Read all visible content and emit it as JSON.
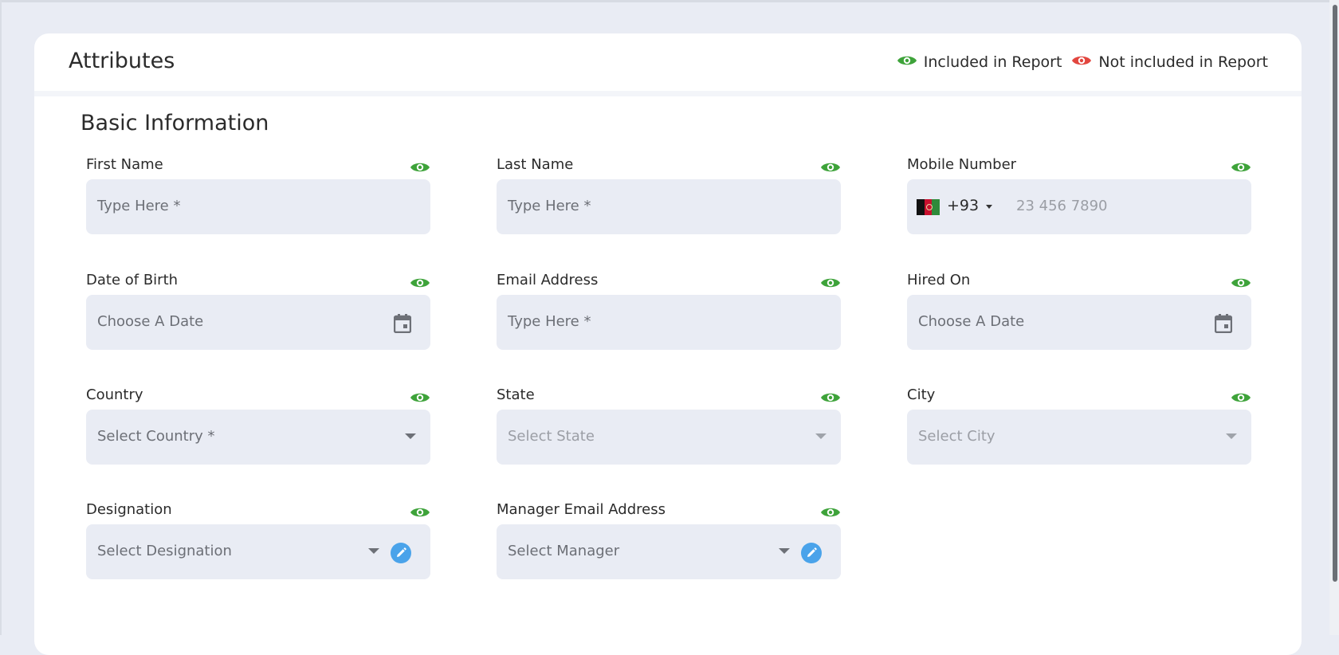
{
  "header": {
    "title": "Attributes",
    "legend": {
      "included": "Included in Report",
      "not_included": "Not included in Report"
    }
  },
  "colors": {
    "included_eye": "#3ea33a",
    "not_included_eye": "#e2463f",
    "edit_button": "#4aa3ea",
    "input_bg": "#e9ecf4"
  },
  "section": {
    "title": "Basic Information"
  },
  "fields": {
    "first_name": {
      "label": "First Name",
      "placeholder": "Type Here *",
      "visibility_icon": "eye-icon"
    },
    "last_name": {
      "label": "Last Name",
      "placeholder": "Type Here *",
      "visibility_icon": "eye-icon"
    },
    "mobile": {
      "label": "Mobile Number",
      "dial_code": "+93",
      "country_flag": "afghanistan-flag-icon",
      "placeholder": "23 456 7890",
      "visibility_icon": "eye-icon"
    },
    "dob": {
      "label": "Date of Birth",
      "placeholder": "Choose A Date",
      "icon": "calendar-icon",
      "visibility_icon": "eye-icon"
    },
    "email": {
      "label": "Email Address",
      "placeholder": "Type Here *",
      "visibility_icon": "eye-icon"
    },
    "hired_on": {
      "label": "Hired On",
      "placeholder": "Choose A Date",
      "icon": "calendar-icon",
      "visibility_icon": "eye-icon"
    },
    "country": {
      "label": "Country",
      "placeholder": "Select Country *",
      "visibility_icon": "eye-icon"
    },
    "state": {
      "label": "State",
      "placeholder": "Select State",
      "visibility_icon": "eye-icon"
    },
    "city": {
      "label": "City",
      "placeholder": "Select City",
      "visibility_icon": "eye-icon"
    },
    "designation": {
      "label": "Designation",
      "placeholder": "Select Designation",
      "icon": "edit-icon",
      "visibility_icon": "eye-icon"
    },
    "manager_email": {
      "label": "Manager Email Address",
      "placeholder": "Select Manager",
      "icon": "edit-icon",
      "visibility_icon": "eye-icon"
    }
  }
}
